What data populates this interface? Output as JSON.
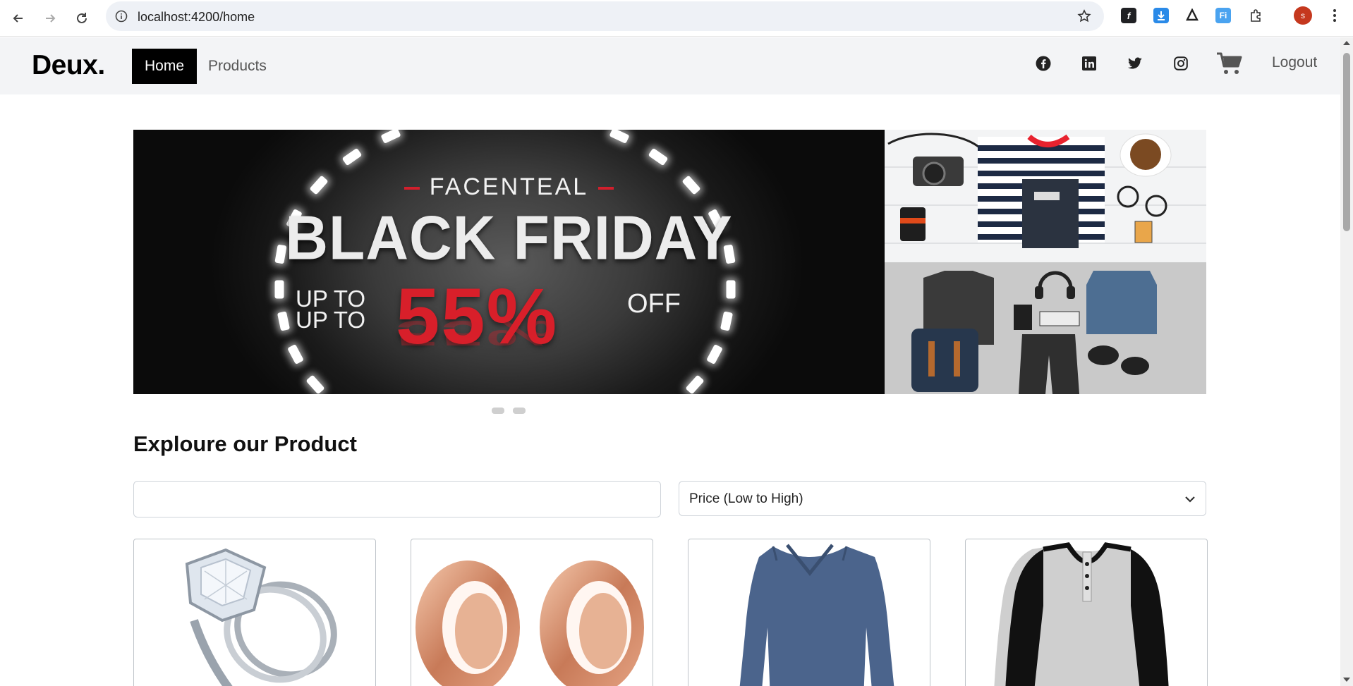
{
  "browser": {
    "url": "localhost:4200/home",
    "profile_initial": "s",
    "extensions": [
      "formula-extension-icon",
      "download-extension-icon",
      "angular-extension-icon",
      "font-extension-icon",
      "puzzle-extension-icon"
    ]
  },
  "navbar": {
    "brand": "Deux.",
    "links": [
      {
        "label": "Home",
        "active": true
      },
      {
        "label": "Products",
        "active": false
      }
    ],
    "social_icons": [
      "facebook-icon",
      "linkedin-icon",
      "twitter-icon",
      "instagram-icon"
    ],
    "cart_icon": "cart-icon",
    "logout_label": "Logout"
  },
  "carousel": {
    "slide_count": 2,
    "active_index": 0,
    "banner": {
      "brand": "FACENTEAL",
      "headline": "BLACK FRIDAY",
      "upto_line1": "UP TO",
      "upto_line2": "UP TO",
      "percent": "55%",
      "off": "OFF"
    }
  },
  "products_section": {
    "title": "Exploure our Product",
    "search": {
      "value": "",
      "placeholder": ""
    },
    "sort": {
      "selected": "Price (Low to High)"
    },
    "cards": [
      {
        "image": "diamond-ring"
      },
      {
        "image": "rose-gold-tunnels"
      },
      {
        "image": "blue-v-neck-longsleeve"
      },
      {
        "image": "raglan-henley-shirt"
      }
    ]
  },
  "colors": {
    "navbar_bg": "#f3f4f6",
    "active_link_bg": "#000000",
    "accent_red": "#d81f2a",
    "profile": "#c5381e"
  }
}
